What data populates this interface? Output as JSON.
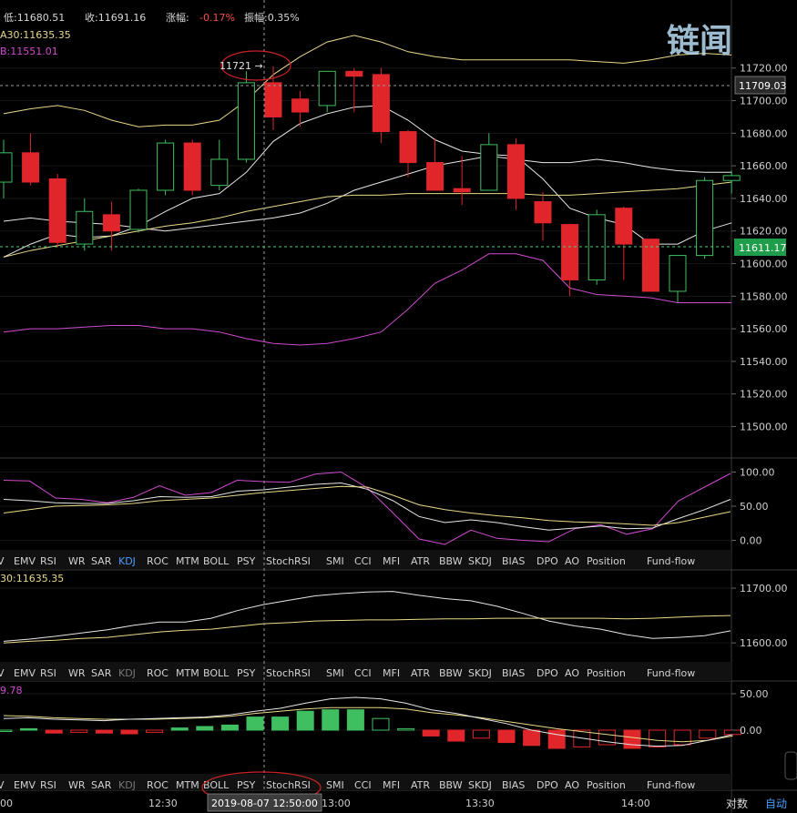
{
  "header": {
    "low_label": "低:11680.51",
    "close_label": "收:11691.16",
    "change_prefix": "涨幅:",
    "change_value": "-0.17%",
    "amplitude_label": "振幅:0.35%",
    "ma30_label": "A30:11635.35",
    "boll_label": "B:11551.01"
  },
  "watermark": "链闻",
  "annotations": {
    "high_marker": "11721 →",
    "crosshair_time": "2019-08-07 12:50:00",
    "last_price": "11611.17",
    "current_price": "11709.03"
  },
  "indicator_tabs": [
    "V",
    "EMV",
    "RSI",
    "WR",
    "SAR",
    "KDJ",
    "ROC",
    "MTM",
    "BOLL",
    "PSY",
    "StochRSI",
    "SMI",
    "CCI",
    "MFI",
    "ATR",
    "BBW",
    "SKDJ",
    "BIAS",
    "DPO",
    "AO",
    "Position",
    "Fund-flow"
  ],
  "active_indicator": "KDJ",
  "x_axis": {
    "labels": [
      "00",
      "12:30",
      "13:00",
      "13:30",
      "14:00"
    ],
    "log_button": "对数",
    "auto_button": "自动"
  },
  "panels": {
    "ma_panel_label": "30:11635.35",
    "macd_label": "9.78"
  },
  "colors": {
    "up": "#3fbf5f",
    "down": "#e0262b",
    "ma_yellow": "#e8d989",
    "white_line": "#e6e6e6",
    "magenta": "#d04ad0",
    "axis_text": "#cfcfcf",
    "last_price_bg": "#1f9d4a"
  },
  "chart_data": [
    {
      "type": "candlestick",
      "title": "",
      "y_ticks": [
        11720,
        11700,
        11680,
        11660,
        11640,
        11620,
        11600,
        11580,
        11560,
        11540,
        11520,
        11500
      ],
      "ylim": [
        11488,
        11745
      ],
      "candles": [
        {
          "o": 11650,
          "h": 11676,
          "l": 11640,
          "c": 11668
        },
        {
          "o": 11668,
          "h": 11680,
          "l": 11648,
          "c": 11650
        },
        {
          "o": 11652,
          "h": 11655,
          "l": 11610,
          "c": 11613
        },
        {
          "o": 11612,
          "h": 11640,
          "l": 11608,
          "c": 11632
        },
        {
          "o": 11630,
          "h": 11638,
          "l": 11608,
          "c": 11620
        },
        {
          "o": 11621,
          "h": 11646,
          "l": 11619,
          "c": 11645
        },
        {
          "o": 11645,
          "h": 11676,
          "l": 11642,
          "c": 11674
        },
        {
          "o": 11674,
          "h": 11676,
          "l": 11642,
          "c": 11645
        },
        {
          "o": 11648,
          "h": 11676,
          "l": 11645,
          "c": 11664
        },
        {
          "o": 11664,
          "h": 11718,
          "l": 11662,
          "c": 11711
        },
        {
          "o": 11711,
          "h": 11721,
          "l": 11682,
          "c": 11690
        },
        {
          "o": 11701,
          "h": 11706,
          "l": 11684,
          "c": 11693
        },
        {
          "o": 11697,
          "h": 11718,
          "l": 11693,
          "c": 11718
        },
        {
          "o": 11718,
          "h": 11720,
          "l": 11693,
          "c": 11715
        },
        {
          "o": 11716,
          "h": 11720,
          "l": 11674,
          "c": 11681
        },
        {
          "o": 11681,
          "h": 11682,
          "l": 11653,
          "c": 11662
        },
        {
          "o": 11662,
          "h": 11677,
          "l": 11645,
          "c": 11645
        },
        {
          "o": 11646,
          "h": 11666,
          "l": 11636,
          "c": 11644
        },
        {
          "o": 11645,
          "h": 11680,
          "l": 11645,
          "c": 11673
        },
        {
          "o": 11673,
          "h": 11677,
          "l": 11633,
          "c": 11640
        },
        {
          "o": 11638,
          "h": 11644,
          "l": 11614,
          "c": 11625
        },
        {
          "o": 11624,
          "h": 11624,
          "l": 11580,
          "c": 11590
        },
        {
          "o": 11590,
          "h": 11633,
          "l": 11587,
          "c": 11630
        },
        {
          "o": 11634,
          "h": 11635,
          "l": 11590,
          "c": 11612
        },
        {
          "o": 11615,
          "h": 11615,
          "l": 11583,
          "c": 11583
        },
        {
          "o": 11583,
          "h": 11605,
          "l": 11576,
          "c": 11605
        },
        {
          "o": 11605,
          "h": 11653,
          "l": 11603,
          "c": 11651
        },
        {
          "o": 11651,
          "h": 11657,
          "l": 11643,
          "c": 11654
        }
      ],
      "lines": [
        {
          "color": "#e8d989",
          "values": [
            11692,
            11695,
            11697,
            11694,
            11688,
            11684,
            11685,
            11685,
            11688,
            11700,
            11716,
            11727,
            11736,
            11740,
            11736,
            11730,
            11727,
            11725,
            11725,
            11725,
            11725,
            11725,
            11724,
            11723,
            11725,
            11728,
            11729,
            11728
          ]
        },
        {
          "color": "#e6e6e6",
          "values": [
            11626,
            11628,
            11626,
            11625,
            11624,
            11622,
            11620,
            11622,
            11624,
            11626,
            11628,
            11631,
            11637,
            11645,
            11650,
            11655,
            11660,
            11663,
            11666,
            11664,
            11662,
            11662,
            11664,
            11662,
            11659,
            11657,
            11656,
            11656
          ]
        },
        {
          "color": "#e6e6e6",
          "values": [
            11604,
            11612,
            11618,
            11616,
            11617,
            11623,
            11632,
            11640,
            11643,
            11656,
            11675,
            11686,
            11692,
            11696,
            11697,
            11688,
            11676,
            11669,
            11667,
            11666,
            11652,
            11634,
            11628,
            11624,
            11612,
            11612,
            11620,
            11625
          ]
        },
        {
          "color": "#e8d989",
          "values": [
            11604,
            11608,
            11611,
            11614,
            11617,
            11620,
            11623,
            11625,
            11628,
            11632,
            11635,
            11638,
            11641,
            11642,
            11642,
            11643,
            11643,
            11643,
            11643,
            11643,
            11642,
            11642,
            11643,
            11644,
            11645,
            11646,
            11648,
            11650
          ]
        },
        {
          "color": "#d04ad0",
          "values": [
            11558,
            11560,
            11560,
            11561,
            11562,
            11562,
            11560,
            11560,
            11558,
            11554,
            11551,
            11550,
            11551,
            11554,
            11558,
            11572,
            11588,
            11596,
            11606,
            11606,
            11602,
            11585,
            11581,
            11580,
            11579,
            11576,
            11576,
            11576
          ]
        }
      ]
    },
    {
      "type": "line",
      "title": "KDJ",
      "y_ticks": [
        100.0,
        50.0,
        0.0
      ],
      "ylim": [
        -14,
        118
      ],
      "series": [
        {
          "color": "#d04ad0",
          "values": [
            88,
            87,
            62,
            60,
            55,
            63,
            80,
            66,
            70,
            88,
            86,
            85,
            97,
            100,
            77,
            40,
            2,
            -6,
            15,
            3,
            0,
            -2,
            17,
            23,
            9,
            17,
            58,
            78,
            98
          ]
        },
        {
          "color": "#e6e6e6",
          "values": [
            60,
            58,
            55,
            54,
            54,
            58,
            64,
            63,
            64,
            72,
            74,
            78,
            82,
            84,
            75,
            58,
            35,
            26,
            30,
            26,
            20,
            15,
            18,
            21,
            17,
            18,
            32,
            45,
            60
          ]
        },
        {
          "color": "#e8d989",
          "values": [
            40,
            45,
            50,
            51,
            52,
            54,
            58,
            60,
            62,
            66,
            70,
            73,
            76,
            79,
            78,
            66,
            52,
            45,
            40,
            36,
            33,
            29,
            27,
            26,
            24,
            22,
            26,
            34,
            42
          ]
        }
      ]
    },
    {
      "type": "line",
      "title": "MA",
      "y_ticks": [
        11700.0,
        11600.0
      ],
      "ylim": [
        11567,
        11730
      ],
      "series": [
        {
          "color": "#e6e6e6",
          "values": [
            11603,
            11607,
            11612,
            11618,
            11624,
            11632,
            11638,
            11638,
            11645,
            11659,
            11670,
            11678,
            11686,
            11690,
            11693,
            11694,
            11687,
            11681,
            11677,
            11667,
            11654,
            11640,
            11631,
            11625,
            11615,
            11608,
            11610,
            11613,
            11622
          ]
        },
        {
          "color": "#e8d989",
          "values": [
            11600,
            11603,
            11605,
            11608,
            11610,
            11615,
            11620,
            11623,
            11625,
            11630,
            11635,
            11637,
            11640,
            11641,
            11642,
            11642,
            11643,
            11644,
            11644,
            11645,
            11645,
            11645,
            11645,
            11645,
            11644,
            11645,
            11647,
            11649,
            11650
          ]
        }
      ]
    },
    {
      "type": "bar",
      "title": "MACD",
      "y_ticks": [
        50.0,
        0.0
      ],
      "ylim": [
        -60,
        65
      ],
      "bars": [
        0,
        2,
        -4,
        -3,
        -4,
        -5,
        -3,
        3,
        5,
        7,
        18,
        18,
        26,
        28,
        28,
        16,
        2,
        -8,
        -15,
        -11,
        -17,
        -21,
        -25,
        -23,
        -20,
        -25,
        -23,
        -20,
        -11,
        -6
      ],
      "series": [
        {
          "color": "#e8d989",
          "values": [
            20,
            19,
            17,
            16,
            15,
            15,
            15,
            16,
            17,
            19,
            23,
            26,
            29,
            31,
            31,
            31,
            29,
            24,
            21,
            17,
            12,
            7,
            2,
            -2,
            -6,
            -10,
            -14,
            -16,
            -14,
            -8
          ]
        },
        {
          "color": "#e6e6e6",
          "values": [
            16,
            17,
            15,
            14,
            13,
            15,
            16,
            17,
            18,
            21,
            26,
            30,
            37,
            43,
            45,
            43,
            37,
            28,
            23,
            16,
            9,
            0,
            -6,
            -11,
            -16,
            -20,
            -22,
            -21,
            -14,
            -6
          ]
        }
      ]
    }
  ]
}
